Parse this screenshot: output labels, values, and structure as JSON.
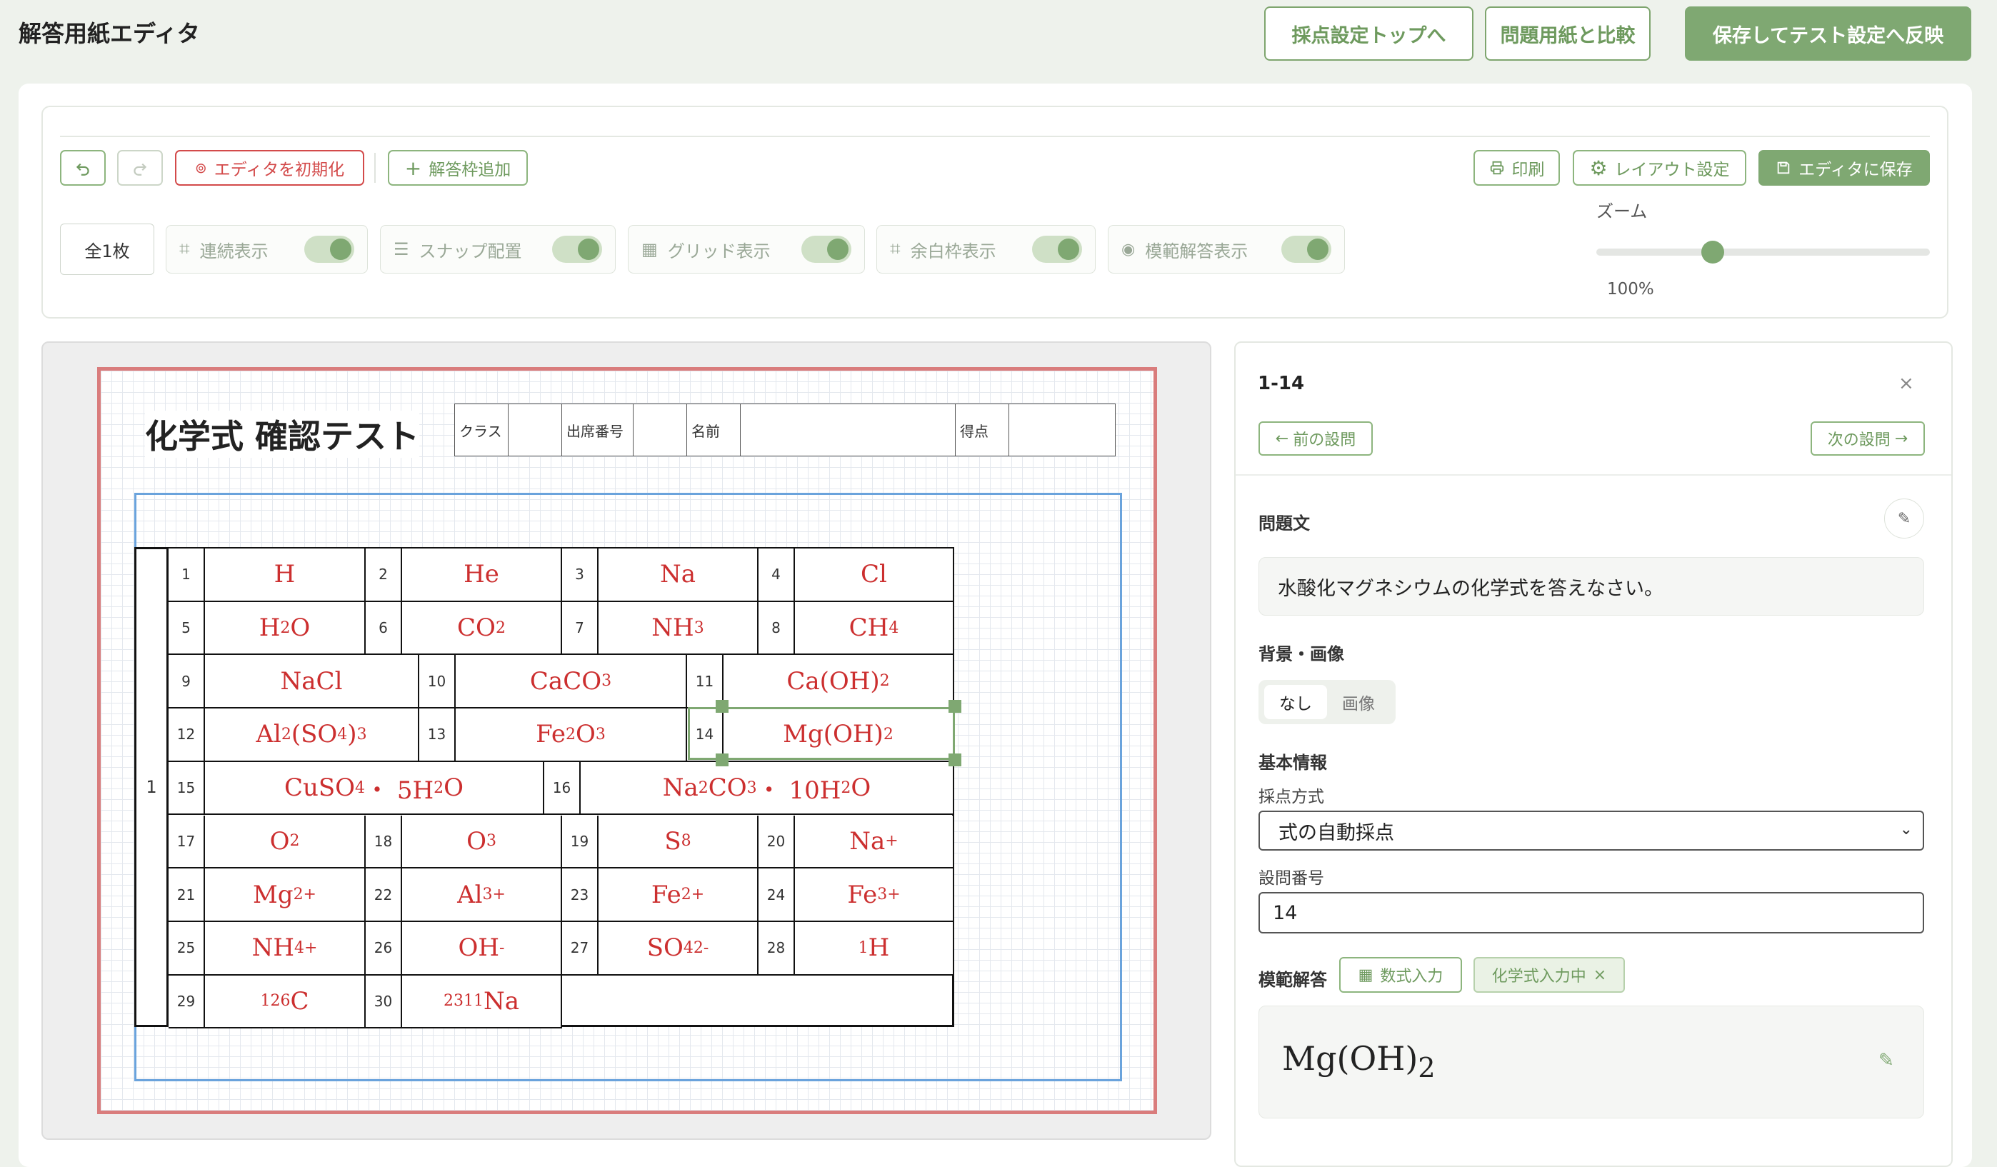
{
  "app": {
    "title": "解答用紙エディタ"
  },
  "header": {
    "btn_top": "採点設定トップへ",
    "btn_compare": "問題用紙と比較",
    "btn_save_apply": "保存してテスト設定へ反映"
  },
  "toolbar": {
    "reset_label": "エディタを初期化",
    "add_label": "解答枠追加",
    "print_label": "印刷",
    "layout_label": "レイアウト設定",
    "save_label": "エディタに保存",
    "pages_label": "全1枚",
    "toggles": [
      {
        "label": "連続表示",
        "icon": "hash-icon",
        "on": true
      },
      {
        "label": "スナップ配置",
        "icon": "list-icon",
        "on": true
      },
      {
        "label": "グリッド表示",
        "icon": "grid-icon",
        "on": true
      },
      {
        "label": "余白枠表示",
        "icon": "hash-icon",
        "on": true
      },
      {
        "label": "模範解答表示",
        "icon": "eye-icon",
        "on": true
      }
    ],
    "zoom_label": "ズーム",
    "zoom_value": "100%",
    "zoom_fraction": 0.35
  },
  "sheet": {
    "title": "化学式 確認テスト",
    "header_fields": [
      "クラス",
      "出席番号",
      "名前",
      "得点"
    ],
    "section_number": "1",
    "rows": [
      {
        "q": [
          {
            "n": "1",
            "html": "H"
          },
          {
            "n": "2",
            "html": "He"
          },
          {
            "n": "3",
            "html": "Na"
          },
          {
            "n": "4",
            "html": "Cl"
          }
        ]
      },
      {
        "q": [
          {
            "n": "5",
            "html": "H<sub>2</sub>O"
          },
          {
            "n": "6",
            "html": "CO<sub>2</sub>"
          },
          {
            "n": "7",
            "html": "NH<sub>3</sub>"
          },
          {
            "n": "8",
            "html": "CH<sub>4</sub>"
          }
        ]
      },
      {
        "q": [
          {
            "n": "9",
            "html": "NaCl"
          },
          {
            "n": "10",
            "html": "CaCO<sub>3</sub>"
          },
          {
            "n": "11",
            "html": "Ca(OH)<sub>2</sub>"
          }
        ]
      },
      {
        "q": [
          {
            "n": "12",
            "html": "Al<sub>2</sub>(SO<sub>4</sub>)<sub>3</sub>"
          },
          {
            "n": "13",
            "html": "Fe<sub>2</sub>O<sub>3</sub>"
          },
          {
            "n": "14",
            "html": "Mg(OH)<sub>2</sub>"
          }
        ]
      },
      {
        "q": [
          {
            "n": "15",
            "html": "CuSO<sub>4</sub> ・ 5H<sub>2</sub>O"
          },
          {
            "n": "16",
            "html": "Na<sub>2</sub>CO<sub>3</sub> ・ 10H<sub>2</sub>O"
          }
        ]
      },
      {
        "q": [
          {
            "n": "17",
            "html": "O<sub>2</sub>"
          },
          {
            "n": "18",
            "html": "O<sub>3</sub>"
          },
          {
            "n": "19",
            "html": "S<sub>8</sub>"
          },
          {
            "n": "20",
            "html": "Na<sup>+</sup>"
          }
        ]
      },
      {
        "q": [
          {
            "n": "21",
            "html": "Mg<sup>2+</sup>"
          },
          {
            "n": "22",
            "html": "Al<sup>3+</sup>"
          },
          {
            "n": "23",
            "html": "Fe<sup>2+</sup>"
          },
          {
            "n": "24",
            "html": "Fe<sup>3+</sup>"
          }
        ]
      },
      {
        "q": [
          {
            "n": "25",
            "html": "NH<sub>4</sub><sup>+</sup>"
          },
          {
            "n": "26",
            "html": "OH<sup>-</sup>"
          },
          {
            "n": "27",
            "html": "SO<sub>4</sub><sup>2-</sup>"
          },
          {
            "n": "28",
            "html": "<sup>1</sup>H"
          }
        ]
      },
      {
        "q": [
          {
            "n": "29",
            "html": "<sup>12</sup><sub>6</sub>C"
          },
          {
            "n": "30",
            "html": "<sup>23</sup><sub>11</sub>Na"
          }
        ]
      }
    ]
  },
  "panel": {
    "id": "1-14",
    "prev_label": "前の設問",
    "next_label": "次の設問",
    "question_heading": "問題文",
    "question_text": "水酸化マグネシウムの化学式を答えなさい。",
    "bg_heading": "背景・画像",
    "bg_options": [
      "なし",
      "画像"
    ],
    "bg_selected": "なし",
    "basic_heading": "基本情報",
    "scoring_label": "採点方式",
    "scoring_value": "式の自動採点",
    "number_label": "設問番号",
    "number_value": "14",
    "model_heading": "模範解答",
    "math_input_label": "数式入力",
    "chem_input_label": "化学式入力中",
    "model_answer_html": "Mg(OH)<sub>2</sub>"
  },
  "colors": {
    "accent": "#7fa872",
    "answer_red": "#cc2f2f",
    "sheet_border": "#d97c7c",
    "selection_blue": "#6aa3dc"
  }
}
